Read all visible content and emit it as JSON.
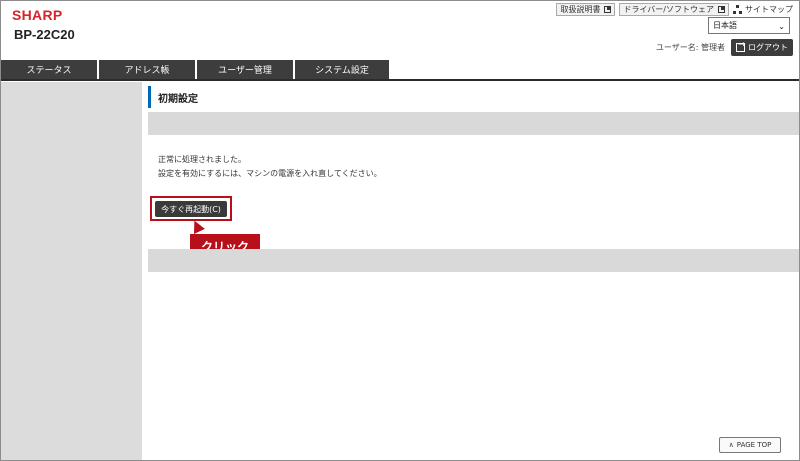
{
  "header": {
    "brand": "SHARP",
    "model": "BP-22C20",
    "links": [
      {
        "label": "取扱説明書",
        "icon": "external-icon"
      },
      {
        "label": "ドライバー/ソフトウェア",
        "icon": "external-icon"
      }
    ],
    "sitemap_label": "サイトマップ",
    "language": "日本語",
    "username": "ユーザー名: 管理者",
    "logout_label": "ログアウト"
  },
  "nav": {
    "tabs": [
      "ステータス",
      "アドレス帳",
      "ユーザー管理",
      "システム設定"
    ]
  },
  "main": {
    "title": "初期設定",
    "messages": [
      "正常に処理されました。",
      "設定を有効にするには、マシンの電源を入れ直してください。"
    ],
    "restart_label": "今すぐ再起動(C)",
    "callout": "クリック",
    "page_top": "PAGE TOP"
  },
  "colors": {
    "brand_red": "#d8232a",
    "highlight_red": "#b7101a",
    "title_accent": "#0069b4",
    "tab_bg": "#3d3d3d"
  }
}
